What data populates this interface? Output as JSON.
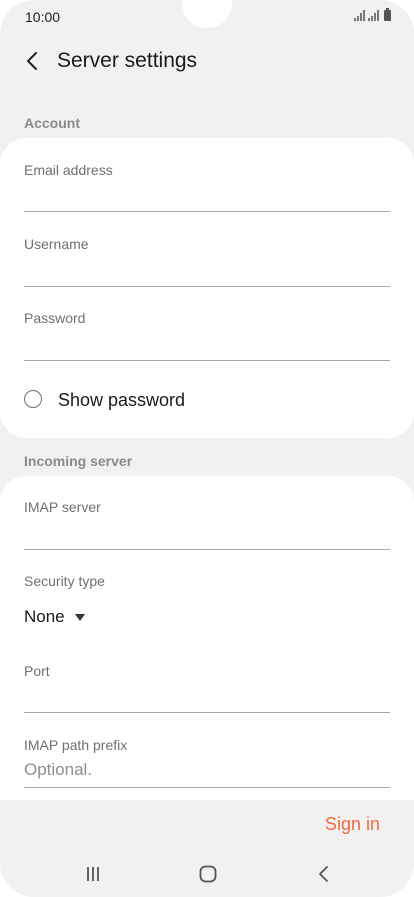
{
  "status_bar": {
    "time": "10:00"
  },
  "header": {
    "title": "Server settings",
    "back_icon": "chevron-left-icon"
  },
  "account": {
    "section_label": "Account",
    "email_label": "Email address",
    "email_value": "",
    "username_label": "Username",
    "username_value": "",
    "password_label": "Password",
    "password_value": "",
    "show_password_label": "Show password",
    "show_password_checked": false
  },
  "incoming_server": {
    "section_label": "Incoming server",
    "imap_server_label": "IMAP server",
    "imap_server_value": "",
    "security_type_label": "Security type",
    "security_type_value": "None",
    "port_label": "Port",
    "port_value": "",
    "imap_path_prefix_label": "IMAP path prefix",
    "imap_path_prefix_placeholder": "Optional."
  },
  "footer": {
    "sign_in_label": "Sign in"
  },
  "colors": {
    "accent": "#f26a3d",
    "background": "#f1f1f1",
    "card": "#ffffff"
  },
  "nav_bar": {
    "icons": [
      "recent-apps-icon",
      "home-icon",
      "back-icon"
    ]
  }
}
